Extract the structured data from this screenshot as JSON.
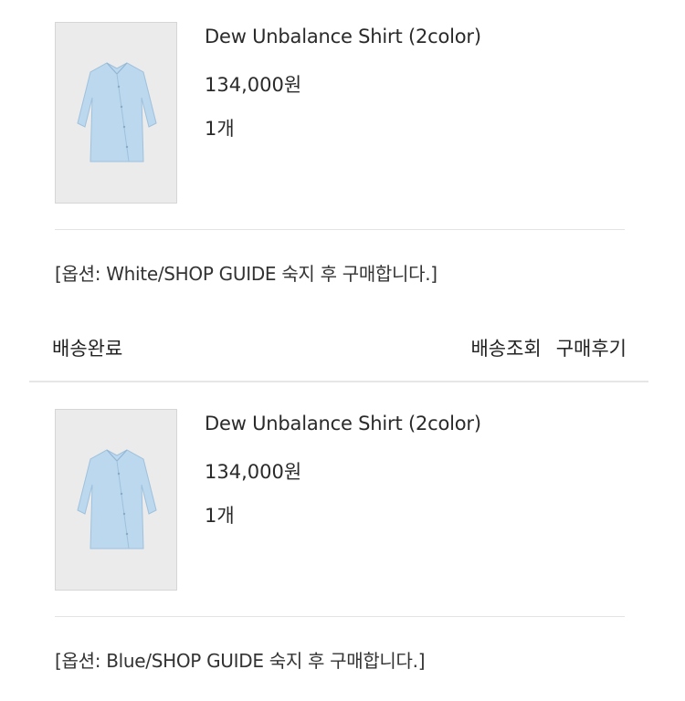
{
  "orders": [
    {
      "product_name": "Dew Unbalance Shirt (2color)",
      "price": "134,000원",
      "quantity": "1개",
      "option": "[옵션: White/SHOP GUIDE 숙지 후 구매합니다.]",
      "thumbnail": "light-blue-shirt-image"
    },
    {
      "product_name": "Dew Unbalance Shirt (2color)",
      "price": "134,000원",
      "quantity": "1개",
      "option": "[옵션: Blue/SHOP GUIDE 숙지 후 구매합니다.]",
      "thumbnail": "light-blue-shirt-image"
    }
  ],
  "status_bar": {
    "status": "배송완료",
    "actions": [
      "배송조회",
      "구매후기"
    ]
  },
  "colors": {
    "shirt": "#bcd8ee",
    "thumb_bg": "#ebebeb",
    "divider": "#e3e3e3"
  }
}
